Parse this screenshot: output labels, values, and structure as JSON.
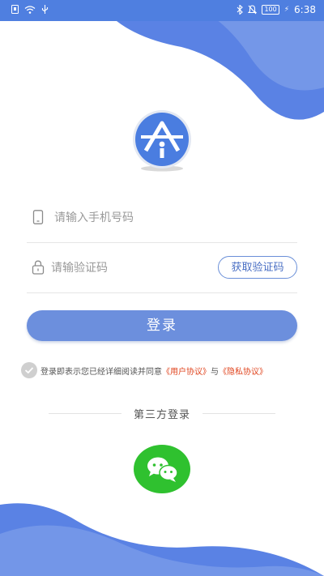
{
  "status_bar": {
    "time": "6:38",
    "battery": "100",
    "bolt": "⚡"
  },
  "login": {
    "phone_placeholder": "请输入手机号码",
    "code_placeholder": "请输验证码",
    "get_code_label": "获取验证码",
    "login_label": "登录"
  },
  "agreement": {
    "prefix": "登录即表示您已经详细阅读并同意",
    "user_agreement": "《用户协议》",
    "conjunction": "与",
    "privacy_policy": "《隐私协议》"
  },
  "third_party": {
    "label": "第三方登录"
  },
  "colors": {
    "primary": "#5a82e4",
    "button": "#6c8fdd",
    "link": "#e0451f",
    "wechat": "#2fc12f"
  }
}
